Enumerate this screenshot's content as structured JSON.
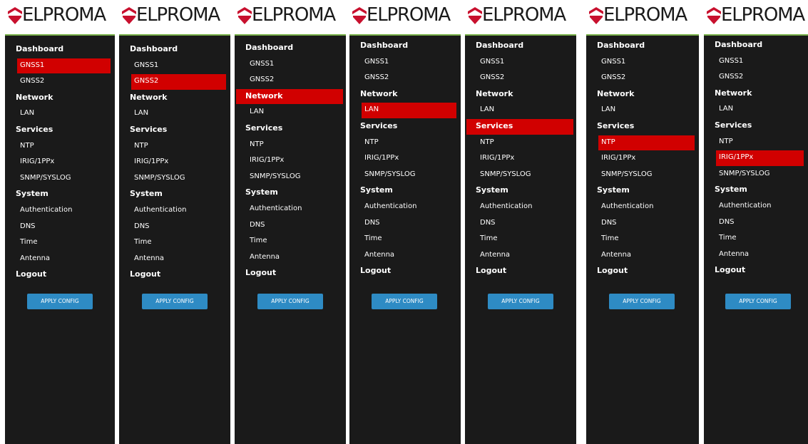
{
  "brand": {
    "name": "ELPROMA",
    "logo_icon": "elproma-shield-icon",
    "accent_line": "#78b04a"
  },
  "colors": {
    "panel_bg": "#1a1a1a",
    "active": "#d10000",
    "button": "#2e8bc4"
  },
  "menu": {
    "dashboard": "Dashboard",
    "gnss1": "GNSS1",
    "gnss2": "GNSS2",
    "network": "Network",
    "lan": "LAN",
    "services": "Services",
    "ntp": "NTP",
    "irig": "IRIG/1PPx",
    "snmp": "SNMP/SYSLOG",
    "system": "System",
    "authentication": "Authentication",
    "dns": "DNS",
    "time": "Time",
    "antenna": "Antenna",
    "logout": "Logout"
  },
  "apply_label": "APPLY CONFIG",
  "panels": [
    {
      "active": "gnss1"
    },
    {
      "active": "gnss2"
    },
    {
      "active": "network"
    },
    {
      "active": "lan"
    },
    {
      "active": "services"
    },
    {
      "active": "ntp"
    },
    {
      "active": "irig"
    }
  ]
}
